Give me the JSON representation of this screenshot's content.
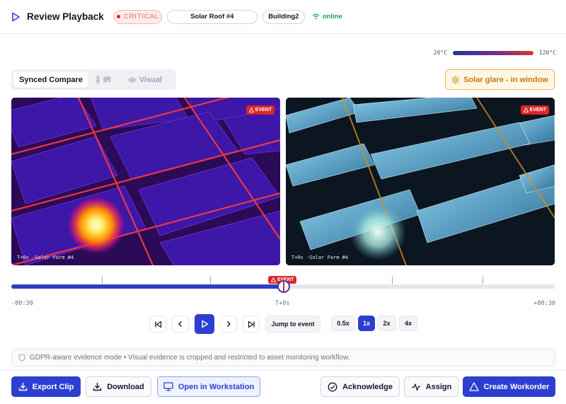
{
  "header": {
    "title": "Review Playback",
    "severity": "CRITICAL",
    "asset": "Solar Roof #4",
    "building": "Building2",
    "connection": "online"
  },
  "legend": {
    "min": "20°C",
    "max": "120°C"
  },
  "view_modes": {
    "synced": "Synced Compare",
    "ir": "IR",
    "visual": "Visual",
    "selected": "Synced Compare"
  },
  "alert": {
    "label": "Solar glare - in window"
  },
  "feeds": {
    "ir": {
      "tag": "EVENT",
      "caption": "T+0s ·Solar Farm #4"
    },
    "visual": {
      "tag": "EVENT",
      "caption": "T+0s ·Solar Farm #4"
    }
  },
  "timeline": {
    "event_tag": "EVENT",
    "start": "-00:30",
    "current": "T+0s",
    "end": "+00:30",
    "progress": 0.5
  },
  "playback": {
    "jump_label": "Jump to event",
    "speeds": [
      "0.5x",
      "1x",
      "2x",
      "4x"
    ],
    "active_speed": "1x"
  },
  "notice": "GDPR-aware evidence mode • Visual evidence is cropped and restricted to asset monitoring workflow.",
  "actions": {
    "export": "Export Clip",
    "download": "Download",
    "workstation": "Open in Workstation",
    "acknowledge": "Acknowledge",
    "assign": "Assign",
    "workorder": "Create Workorder"
  },
  "colors": {
    "accent": "#2d3fd0",
    "critical": "#dc2626",
    "online": "#16a34a",
    "warning": "#c97a06"
  }
}
